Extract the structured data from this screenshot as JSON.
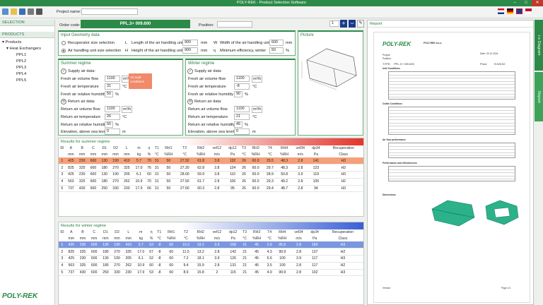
{
  "window": {
    "title": "POLY-REK - Product Selection Software",
    "min": "–",
    "max": "□",
    "close": "✕"
  },
  "toolbar": {
    "project_name_label": "Project name:",
    "project_name_value": "",
    "order_code_label": "Order code:",
    "order_code_value": "PPL.3+ 009.600",
    "position_label": "Position:",
    "position_value": "",
    "qty": "1",
    "plus": "+",
    "minus": "−"
  },
  "sidebar": {
    "selection_header": "SELECTION",
    "products_header": "PRODUCTS",
    "root": "Products",
    "group": "Heat Exchangers",
    "items": [
      "PPL1",
      "PPL2",
      "PPL3",
      "PPL4",
      "PPL5"
    ],
    "logo": "POLY-REK"
  },
  "input": {
    "title": "Input Geometry data",
    "opt1": "Recuperator size selection",
    "opt2": "Air handling unit size selection",
    "L_lbl": "Length of the air handling unit",
    "L_val": "900",
    "L_unit": "mm",
    "H_lbl": "Height of the air handling unit",
    "H_val": "900",
    "H_unit": "mm",
    "W_lbl": "Width of the air handling unit",
    "W_val": "600",
    "W_unit": "mm",
    "eta_lbl": "Minimum efficiency, winter",
    "eta_val": "50",
    "eta_unit": "%",
    "L_key": "L",
    "H_key": "H",
    "W_key": "W",
    "eta_key": "η"
  },
  "picture": {
    "title": "Picture"
  },
  "summer": {
    "title": "Summer regime",
    "supply": "Supply air data:",
    "flow_lbl": "Fresh air volume flow",
    "flow_val": "1100",
    "flow_unit": "m³/h",
    "temp_lbl": "Fresh air temperature",
    "temp_val": "31",
    "temp_unit": "°C",
    "hum_lbl": "Fresh air relative humidity",
    "hum_val": "50",
    "hum_unit": "%",
    "ret": "Return air data:",
    "rflow_lbl": "Return air volume flow",
    "rflow_val": "1100",
    "rflow_unit": "m³/h",
    "rtemp_lbl": "Return air temperature",
    "rtemp_val": "26",
    "rtemp_unit": "°C",
    "rhum_lbl": "Return air relative humidity",
    "rhum_val": "50",
    "rhum_unit": "%",
    "elev_lbl": "Elevation, above sea level",
    "elev_val": "0",
    "elev_unit": "m",
    "warn": "Air read conditions"
  },
  "winter": {
    "title": "Winter regime",
    "supply": "Supply air data:",
    "flow_lbl": "Fresh air volume flow",
    "flow_val": "1100",
    "flow_unit": "m³/h",
    "temp_lbl": "Fresh air temperature",
    "temp_val": "-8",
    "temp_unit": "°C",
    "hum_lbl": "Fresh air relative humidity",
    "hum_val": "90",
    "hum_unit": "%",
    "ret": "Return air data:",
    "rflow_lbl": "Return air volume flow",
    "rflow_val": "1100",
    "rflow_unit": "m³/h",
    "rtemp_lbl": "Return air temperature",
    "rtemp_val": "21",
    "rtemp_unit": "°C",
    "rhum_lbl": "Return air relative humidity",
    "rhum_val": "45",
    "rhum_unit": "%",
    "elev_lbl": "Elevation, above sea level",
    "elev_val": "0",
    "elev_unit": "m"
  },
  "summer_results": {
    "title": "Results for summer regime",
    "headers": [
      "ID",
      "A",
      "B",
      "C",
      "D1",
      "D2",
      "L",
      "m",
      "η",
      "T1",
      "RH1",
      "T2",
      "RH2",
      "vef12",
      "dp12",
      "T3",
      "RH3",
      "T4",
      "RH4",
      "vef34",
      "dp34",
      "Recuperation"
    ],
    "units": [
      "",
      "mm",
      "mm",
      "mm",
      "mm",
      "mm",
      "mm",
      "kg",
      "%",
      "°C",
      "%RH",
      "°C",
      "%RH",
      "m/s",
      "Pa",
      "°C",
      "%RH",
      "°C",
      "%RH",
      "m/s",
      "Pa",
      "Class"
    ],
    "rows": [
      [
        "1",
        "425",
        "230",
        "600",
        "130",
        "190",
        "410",
        "5.7",
        "70",
        "31",
        "50",
        "27.52",
        "61.8",
        "3.8",
        "132",
        "26",
        "60.0",
        "29.5",
        "48.3",
        "2.8",
        "141",
        "H3"
      ],
      [
        "2",
        "825",
        "325",
        "600",
        "180",
        "270",
        "325",
        "17.0",
        "76",
        "31",
        "50",
        "27.20",
        "62.8",
        "2.8",
        "124",
        "26",
        "60.0",
        "29.7",
        "48.3",
        "2.8",
        "123",
        "H2"
      ],
      [
        "3",
        "425",
        "230",
        "600",
        "130",
        "190",
        "205",
        "6.1",
        "60",
        "31",
        "50",
        "28.00",
        "59.9",
        "3.8",
        "110",
        "26",
        "60.0",
        "28.9",
        "50.8",
        "3.9",
        "119",
        "H3"
      ],
      [
        "4",
        "563",
        "325",
        "600",
        "180",
        "270",
        "262",
        "10.9",
        "70",
        "31",
        "50",
        "27.50",
        "61.7",
        "2.8",
        "106",
        "26",
        "60.0",
        "29.3",
        "49.2",
        "2.8",
        "105",
        "H2"
      ],
      [
        "5",
        "737",
        "430",
        "600",
        "250",
        "330",
        "230",
        "17.9",
        "66",
        "31",
        "50",
        "27.60",
        "60.3",
        "2.8",
        "95",
        "26",
        "60.0",
        "29.4",
        "48.7",
        "2.8",
        "94",
        "H3"
      ]
    ],
    "selected": 0
  },
  "winter_results": {
    "title": "Results for winter regime",
    "headers": [
      "ID",
      "A",
      "B",
      "C",
      "D1",
      "D2",
      "L",
      "m",
      "η",
      "T1",
      "RH1",
      "T2",
      "RH2",
      "vef12",
      "dp12",
      "T3",
      "RH3",
      "T4",
      "RH4",
      "vef34",
      "dp34",
      "Recuperation"
    ],
    "units": [
      "",
      "mm",
      "mm",
      "mm",
      "mm",
      "mm",
      "mm",
      "kg",
      "%",
      "°C",
      "%RH",
      "°C",
      "%RH",
      "m/s",
      "Pa",
      "°C",
      "%RH",
      "°C",
      "%RH",
      "m/s",
      "Pa",
      "Class"
    ],
    "rows": [
      [
        "1",
        "425",
        "230",
        "600",
        "130",
        "190",
        "410",
        "5.7",
        "53",
        "-8",
        "60",
        "10.2",
        "19.2",
        "3.9",
        "168",
        "21",
        "45",
        "2.9",
        "95.5",
        "2.8",
        "160",
        "H3"
      ],
      [
        "2",
        "825",
        "325",
        "600",
        "180",
        "270",
        "325",
        "17.0",
        "67",
        "-8",
        "60",
        "11.5",
        "13.2",
        "2.8",
        "142",
        "21",
        "45",
        "4.3",
        "99.9",
        "2.8",
        "137",
        "H2"
      ],
      [
        "3",
        "425",
        "230",
        "600",
        "130",
        "190",
        "205",
        "6.1",
        "52",
        "-8",
        "60",
        "7.2",
        "18.1",
        "3.9",
        "126",
        "21",
        "45",
        "6.6",
        "100",
        "3.9",
        "117",
        "H3"
      ],
      [
        "4",
        "563",
        "325",
        "600",
        "180",
        "270",
        "262",
        "10.9",
        "60",
        "-8",
        "60",
        "9.4",
        "15.9",
        "2.8",
        "131",
        "21",
        "45",
        "3.5",
        "100",
        "2.8",
        "117",
        "H2"
      ],
      [
        "5",
        "737",
        "430",
        "600",
        "250",
        "330",
        "230",
        "17.9",
        "53",
        "-8",
        "60",
        "8.9",
        "15.8",
        "2",
        "115",
        "21",
        "45",
        "4.9",
        "99.9",
        "2.8",
        "102",
        "H3"
      ]
    ],
    "selected": 0
  },
  "report": {
    "title": "Report",
    "vtab1": "i-s Diagram",
    "vtab2": "Report",
    "logo": "POLY-REK",
    "company": "POLY-REK d.o.o.",
    "type_label": "TYPE:",
    "type_value": "PPL.3+ 009.600",
    "price_label": "Price:",
    "price_value": "€ 625.52",
    "inlet": "Inlet Conditions",
    "outlet": "Outlet Conditions",
    "airflow": "Air flow performance",
    "perf": "Performance and effectiveness",
    "dims": "Dimensions",
    "version": "Version:",
    "page": "Page 1/1",
    "date": "Date: 23.12.2016",
    "project_label": "Project:",
    "position_label": "Position:"
  },
  "colors": {
    "brand": "#2c8a48",
    "summer_bar": "#e2352a",
    "winter_bar": "#3b5fd6",
    "selected_summer": "#f5a078",
    "selected_winter": "#7b96e0"
  }
}
